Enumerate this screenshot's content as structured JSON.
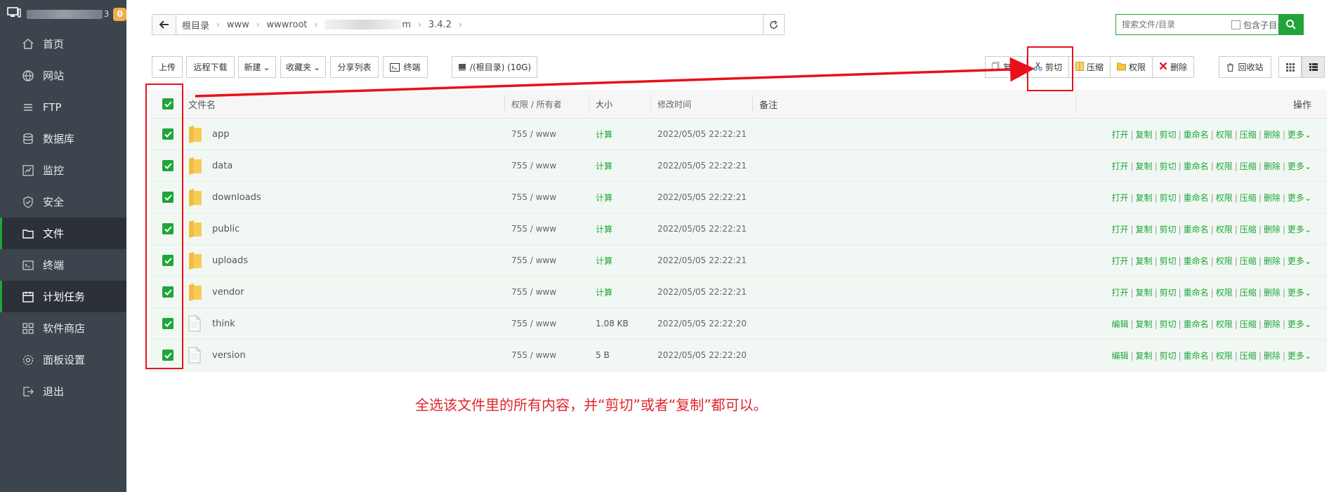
{
  "sidebar": {
    "host_suffix": "3",
    "badge": "0",
    "items": [
      {
        "label": "首页",
        "icon": "home-icon",
        "active": false
      },
      {
        "label": "网站",
        "icon": "globe-icon",
        "active": false
      },
      {
        "label": "FTP",
        "icon": "ftp-icon",
        "active": false
      },
      {
        "label": "数据库",
        "icon": "database-icon",
        "active": false
      },
      {
        "label": "监控",
        "icon": "monitor-icon",
        "active": false
      },
      {
        "label": "安全",
        "icon": "shield-icon",
        "active": false
      },
      {
        "label": "文件",
        "icon": "folder-icon",
        "active": true
      },
      {
        "label": "终端",
        "icon": "terminal-icon",
        "active": false
      },
      {
        "label": "计划任务",
        "icon": "calendar-icon",
        "active": true
      },
      {
        "label": "软件商店",
        "icon": "grid-icon",
        "active": false
      },
      {
        "label": "面板设置",
        "icon": "gear-icon",
        "active": false
      },
      {
        "label": "退出",
        "icon": "logout-icon",
        "active": false
      }
    ]
  },
  "path": {
    "crumbs": [
      "根目录",
      "www",
      "wwwroot",
      "m",
      "3.4.2"
    ]
  },
  "search": {
    "placeholder": "搜索文件/目录",
    "subdir_label": "包含子目录"
  },
  "toolbar": {
    "upload": "上传",
    "remote_download": "远程下载",
    "new": "新建",
    "favorites": "收藏夹",
    "share_list": "分享列表",
    "terminal": "终端",
    "disk": "/(根目录) (10G)",
    "copy": "复制",
    "cut": "剪切",
    "compress": "压缩",
    "permission": "权限",
    "delete": "删除",
    "recycle": "回收站"
  },
  "table": {
    "headers": {
      "name": "文件名",
      "perm": "权限 / 所有者",
      "size": "大小",
      "mtime": "修改时间",
      "note": "备注",
      "ops": "操作"
    },
    "rows": [
      {
        "name": "app",
        "type": "folder",
        "perm": "755 / www",
        "size": "计算",
        "mtime": "2022/05/05 22:22:21",
        "first_op": "打开"
      },
      {
        "name": "data",
        "type": "folder",
        "perm": "755 / www",
        "size": "计算",
        "mtime": "2022/05/05 22:22:21",
        "first_op": "打开"
      },
      {
        "name": "downloads",
        "type": "folder",
        "perm": "755 / www",
        "size": "计算",
        "mtime": "2022/05/05 22:22:21",
        "first_op": "打开"
      },
      {
        "name": "public",
        "type": "folder",
        "perm": "755 / www",
        "size": "计算",
        "mtime": "2022/05/05 22:22:21",
        "first_op": "打开"
      },
      {
        "name": "uploads",
        "type": "folder",
        "perm": "755 / www",
        "size": "计算",
        "mtime": "2022/05/05 22:22:21",
        "first_op": "打开"
      },
      {
        "name": "vendor",
        "type": "folder",
        "perm": "755 / www",
        "size": "计算",
        "mtime": "2022/05/05 22:22:21",
        "first_op": "打开"
      },
      {
        "name": "think",
        "type": "file",
        "perm": "755 / www",
        "size": "1.08 KB",
        "mtime": "2022/05/05 22:22:20",
        "first_op": "编辑"
      },
      {
        "name": "version",
        "type": "file",
        "perm": "755 / www",
        "size": "5 B",
        "mtime": "2022/05/05 22:22:20",
        "first_op": "编辑"
      }
    ],
    "ops": [
      "复制",
      "剪切",
      "重命名",
      "权限",
      "压缩",
      "删除",
      "更多"
    ]
  },
  "annotation": {
    "text": "全选该文件里的所有内容，并“剪切”或者“复制”都可以。"
  },
  "colors": {
    "accent": "#20a53a",
    "sidebar_bg": "#3c444d",
    "annotation": "#e9101b",
    "badge": "#f0ad4e"
  }
}
